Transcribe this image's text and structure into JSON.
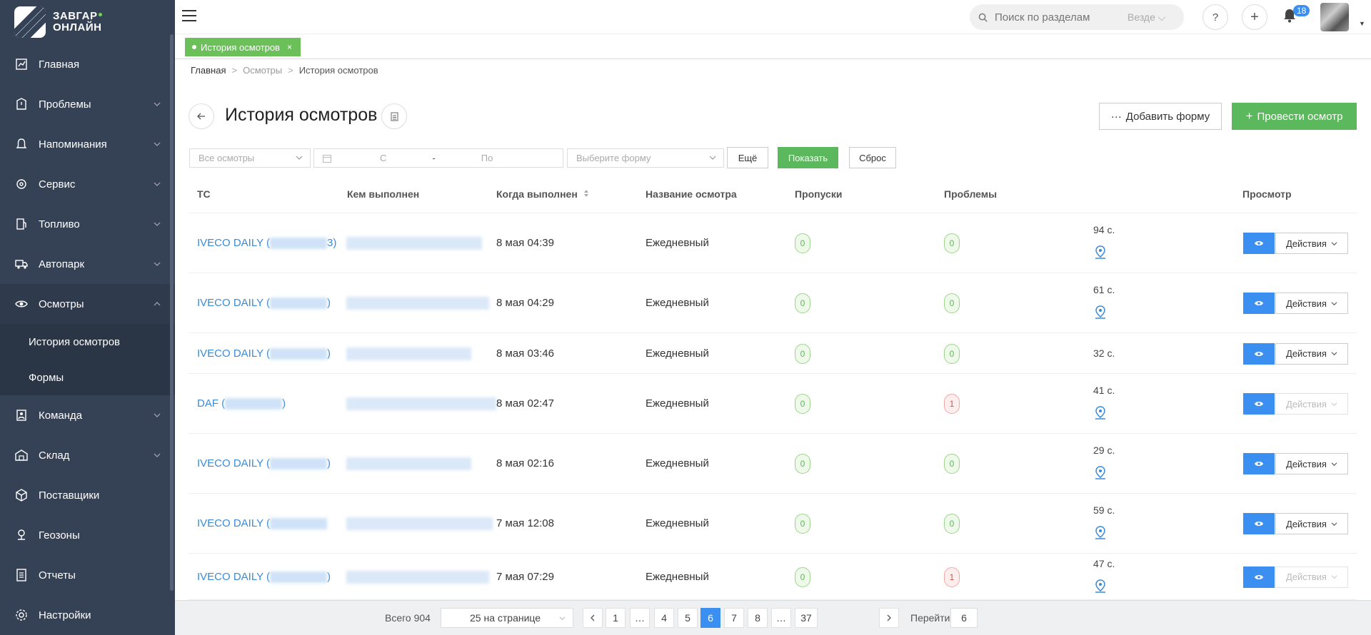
{
  "app": {
    "logo_line1": "ЗАВГАР",
    "logo_line2": "ОНЛАЙН",
    "accent": "#5cb85c",
    "sidebar_bg": "#354256",
    "primary": "#3b8ff0"
  },
  "sidebar": {
    "items": [
      {
        "label": "Главная",
        "icon": "dashboard-icon",
        "has_children": false
      },
      {
        "label": "Проблемы",
        "icon": "problems-icon",
        "has_children": true
      },
      {
        "label": "Напоминания",
        "icon": "bell-icon",
        "has_children": true
      },
      {
        "label": "Сервис",
        "icon": "wrench-icon",
        "has_children": true
      },
      {
        "label": "Топливо",
        "icon": "fuel-icon",
        "has_children": true
      },
      {
        "label": "Автопарк",
        "icon": "truck-icon",
        "has_children": true
      },
      {
        "label": "Осмотры",
        "icon": "eye-icon",
        "has_children": true,
        "expanded": true
      },
      {
        "label": "Команда",
        "icon": "team-icon",
        "has_children": true
      },
      {
        "label": "Склад",
        "icon": "warehouse-icon",
        "has_children": true
      },
      {
        "label": "Поставщики",
        "icon": "box-icon",
        "has_children": false
      },
      {
        "label": "Геозоны",
        "icon": "geo-icon",
        "has_children": false
      },
      {
        "label": "Отчеты",
        "icon": "report-icon",
        "has_children": false
      },
      {
        "label": "Настройки",
        "icon": "gear-icon",
        "has_children": false
      }
    ],
    "submenu": [
      "История осмотров",
      "Формы"
    ]
  },
  "topbar": {
    "search_placeholder": "Поиск по разделам",
    "search_scope": "Везде",
    "help": "?",
    "add": "+",
    "notifications": "18"
  },
  "tabs": [
    {
      "label": "История осмотров",
      "close": "×"
    }
  ],
  "breadcrumb": {
    "home": "Главная",
    "section": "Осмотры",
    "current": "История осмотров",
    "sep": ">"
  },
  "page": {
    "title": "История осмотров",
    "add_form": "Добавить форму",
    "conduct": "Провести осмотр"
  },
  "filters": {
    "all": "Все осмотры",
    "date_from": "С",
    "date_dash": "-",
    "date_to": "По",
    "form": "Выберите форму",
    "more": "Ещё",
    "show": "Показать",
    "reset": "Сброс"
  },
  "table": {
    "headers": [
      "ТС",
      "Кем выполнен",
      "Когда выполнен",
      "Название осмотра",
      "Пропуски",
      "Проблемы",
      "Просмотр"
    ],
    "rows": [
      {
        "vehicle": "IVECO DAILY (",
        "vehicle_end": "3)",
        "when": "8 мая 04:39",
        "name": "Ежедневный",
        "skips": "0",
        "problems": "0",
        "problems_status": "ok",
        "duration": "94 с.",
        "has_pin": true,
        "actions": "Действия",
        "actions_dim": false
      },
      {
        "vehicle": "IVECO DAILY (",
        "vehicle_end": ")",
        "when": "8 мая 04:29",
        "name": "Ежедневный",
        "skips": "0",
        "problems": "0",
        "problems_status": "ok",
        "duration": "61 с.",
        "has_pin": true,
        "actions": "Действия",
        "actions_dim": false
      },
      {
        "vehicle": "IVECO DAILY (",
        "vehicle_end": ")",
        "when": "8 мая 03:46",
        "name": "Ежедневный",
        "skips": "0",
        "problems": "0",
        "problems_status": "ok",
        "duration": "32 с.",
        "has_pin": false,
        "actions": "Действия",
        "actions_dim": false
      },
      {
        "vehicle": "DAF (",
        "vehicle_end": ")",
        "when": "8 мая 02:47",
        "name": "Ежедневный",
        "skips": "0",
        "problems": "1",
        "problems_status": "bad",
        "duration": "41 с.",
        "has_pin": true,
        "actions": "Действия",
        "actions_dim": true
      },
      {
        "vehicle": "IVECO DAILY (",
        "vehicle_end": ")",
        "when": "8 мая 02:16",
        "name": "Ежедневный",
        "skips": "0",
        "problems": "0",
        "problems_status": "ok",
        "duration": "29 с.",
        "has_pin": true,
        "actions": "Действия",
        "actions_dim": false
      },
      {
        "vehicle": "IVECO DAILY (",
        "vehicle_end": "",
        "when": "7 мая 12:08",
        "name": "Ежедневный",
        "skips": "0",
        "problems": "0",
        "problems_status": "ok",
        "duration": "59 с.",
        "has_pin": true,
        "actions": "Действия",
        "actions_dim": false
      },
      {
        "vehicle": "IVECO DAILY (",
        "vehicle_end": ")",
        "when": "7 мая 07:29",
        "name": "Ежедневный",
        "skips": "0",
        "problems": "1",
        "problems_status": "bad",
        "duration": "47 с.",
        "has_pin": true,
        "actions": "Действия",
        "actions_dim": true
      }
    ]
  },
  "pagination": {
    "total": "Всего 904",
    "per_page": "25 на странице",
    "pages": [
      "1",
      "…",
      "4",
      "5",
      "6",
      "7",
      "8",
      "…",
      "37"
    ],
    "current": "6",
    "goto_label": "Перейти",
    "goto_value": "6"
  }
}
